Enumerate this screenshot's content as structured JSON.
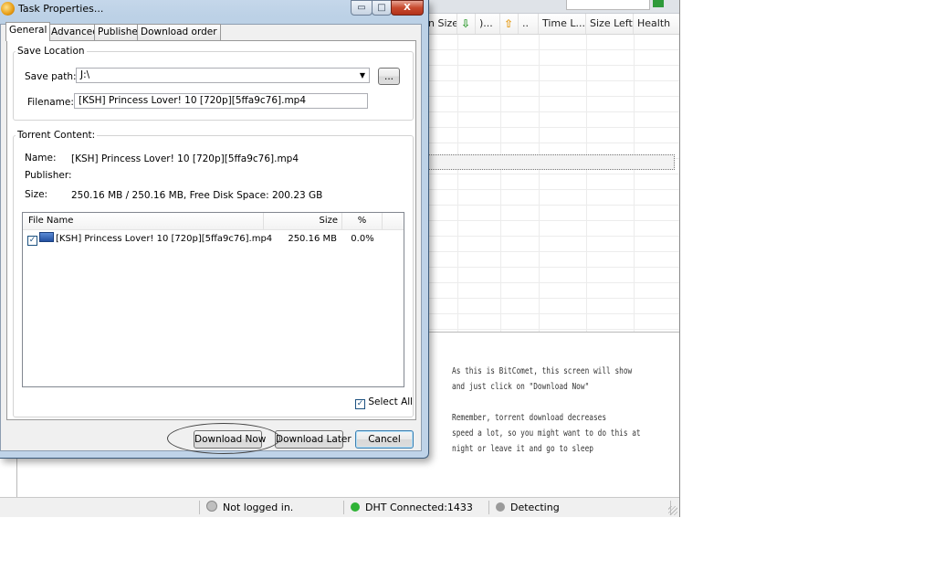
{
  "main_window": {
    "columns": [
      {
        "label": "n Size",
        "icon": "",
        "w": 36
      },
      {
        "label": "",
        "icon": "down-arrow-icon",
        "w": 20
      },
      {
        "label": ")...",
        "icon": "",
        "w": 27
      },
      {
        "label": "",
        "icon": "up-arrow-icon",
        "w": 20
      },
      {
        "label": "..",
        "icon": "",
        "w": 22
      },
      {
        "label": "Time L...",
        "icon": "",
        "w": 52
      },
      {
        "label": "Size Left",
        "icon": "",
        "w": 52
      },
      {
        "label": "Health",
        "icon": "",
        "w": 50
      }
    ],
    "annotation": [
      "As this is BitComet, this screen will show",
      "and just click on \"Download Now\"",
      "",
      "Remember, torrent download decreases",
      "speed a lot, so you might want to do this at",
      "night or leave it and go to sleep"
    ],
    "status": {
      "login": "Not logged in.",
      "dht": "DHT Connected:1433",
      "detect": "Detecting"
    },
    "colors": {
      "dht_dot": "#2fb336",
      "login_dot": "#bfbfbf",
      "detect_dot": "#9a9a9a"
    }
  },
  "dialog": {
    "title": "Task Properties...",
    "window_buttons": {
      "minimize": "▭",
      "maximize": "□",
      "close": "X"
    },
    "tabs": [
      "General",
      "Advanced",
      "Publisher",
      "Download order"
    ],
    "save_location": {
      "group_label": "Save Location",
      "save_path_label": "Save path:",
      "save_path_value": "J:\\",
      "browse_label": "...",
      "filename_label": "Filename:",
      "filename_value": "[KSH] Princess Lover! 10 [720p][5ffa9c76].mp4"
    },
    "torrent_content": {
      "group_label": "Torrent Content:",
      "name_label": "Name:",
      "name_value": "[KSH] Princess Lover! 10 [720p][5ffa9c76].mp4",
      "publisher_label": "Publisher:",
      "publisher_value": "",
      "size_label": "Size:",
      "size_value": "250.16 MB / 250.16 MB, Free Disk Space: 200.23 GB"
    },
    "file_list": {
      "headers": {
        "name": "File Name",
        "size": "Size",
        "percent": "%"
      },
      "rows": [
        {
          "checked": true,
          "name": "[KSH] Princess Lover! 10 [720p][5ffa9c76].mp4",
          "size": "250.16 MB",
          "percent": "0.0%"
        }
      ]
    },
    "select_all_label": "Select All",
    "buttons": {
      "download_now": "Download Now",
      "download_later": "Download Later",
      "cancel": "Cancel"
    }
  }
}
